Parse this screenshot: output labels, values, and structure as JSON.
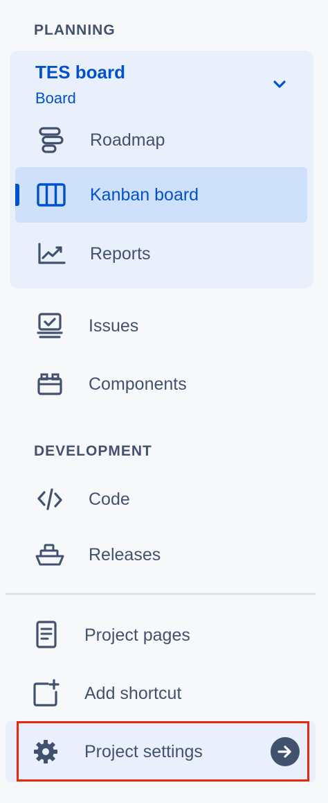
{
  "sections": {
    "planning": "PLANNING",
    "development": "DEVELOPMENT"
  },
  "board": {
    "title": "TES board",
    "subtitle": "Board"
  },
  "items": {
    "roadmap": "Roadmap",
    "kanban": "Kanban board",
    "reports": "Reports",
    "issues": "Issues",
    "components": "Components",
    "code": "Code",
    "releases": "Releases",
    "project_pages": "Project pages",
    "add_shortcut": "Add shortcut",
    "project_settings": "Project settings"
  },
  "colors": {
    "accent": "#0052cc",
    "text": "#42526e",
    "highlight": "#e8270e"
  },
  "icons": {
    "roadmap": "roadmap-icon",
    "kanban": "kanban-columns-icon",
    "reports": "chart-trend-icon",
    "issues": "issues-stack-icon",
    "components": "components-icon",
    "code": "code-icon",
    "releases": "ship-icon",
    "project_pages": "page-icon",
    "add_shortcut": "add-shortcut-icon",
    "project_settings": "gear-icon",
    "arrow": "arrow-right-icon"
  }
}
